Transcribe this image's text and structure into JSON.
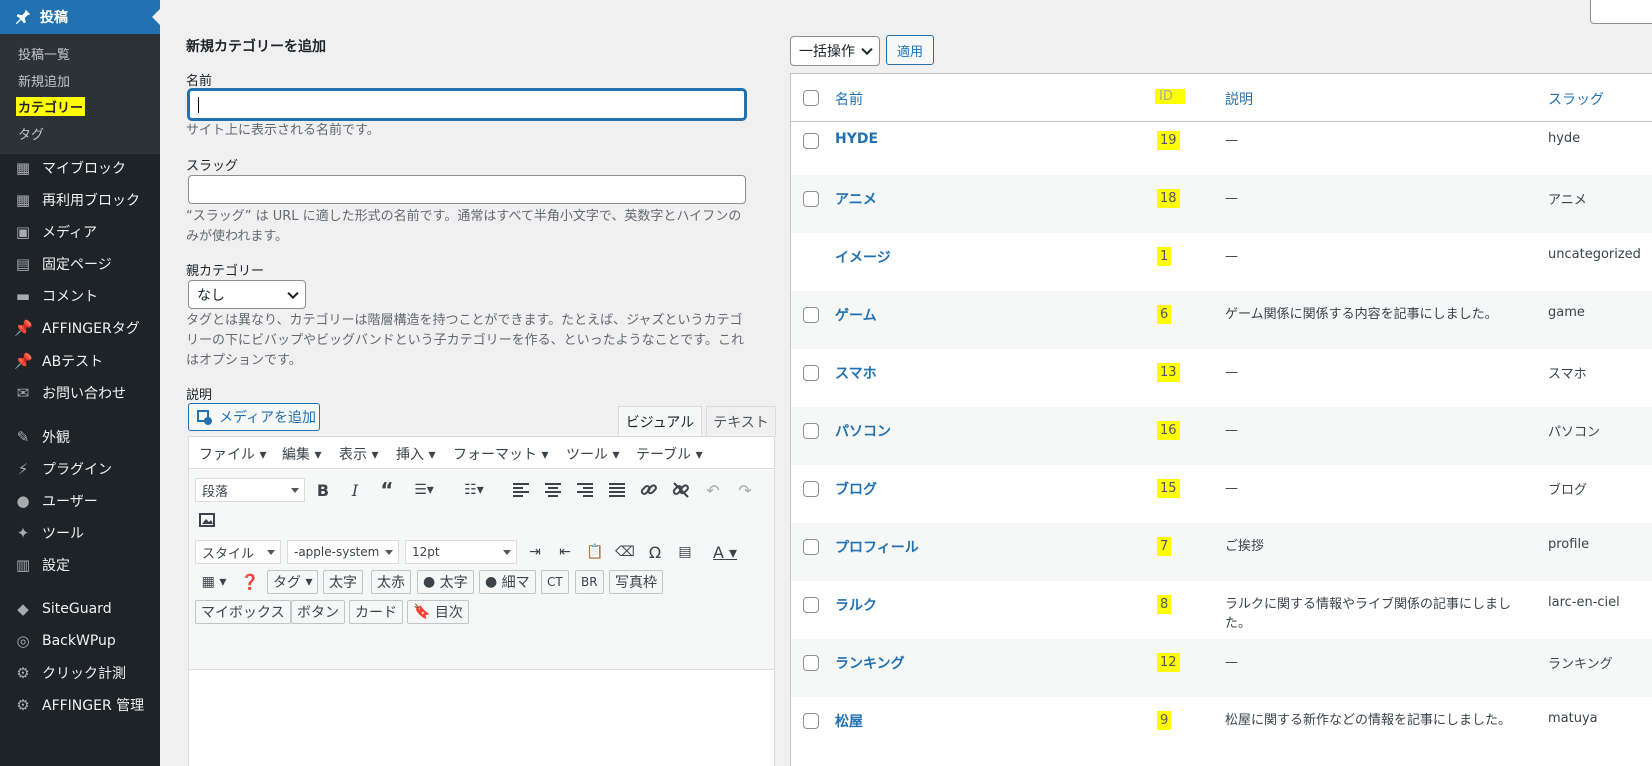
{
  "sidebar": {
    "active": {
      "label": "投稿",
      "icon": "pin-icon"
    },
    "submenu": [
      "投稿一覧",
      "新規追加",
      "カテゴリー",
      "タグ"
    ],
    "items": [
      {
        "label": "マイブロック",
        "icon": "grid-icon"
      },
      {
        "label": "再利用ブロック",
        "icon": "grid-icon"
      },
      {
        "label": "メディア",
        "icon": "media-icon"
      },
      {
        "label": "固定ページ",
        "icon": "pages-icon"
      },
      {
        "label": "コメント",
        "icon": "comment-icon"
      },
      {
        "label": "AFFINGERタグ",
        "icon": "pin-icon"
      },
      {
        "label": "ABテスト",
        "icon": "pin-icon"
      },
      {
        "label": "お問い合わせ",
        "icon": "mail-icon"
      },
      {
        "label": "外観",
        "icon": "brush-icon"
      },
      {
        "label": "プラグイン",
        "icon": "plugin-icon"
      },
      {
        "label": "ユーザー",
        "icon": "user-icon"
      },
      {
        "label": "ツール",
        "icon": "wrench-icon"
      },
      {
        "label": "設定",
        "icon": "settings-icon"
      },
      {
        "label": "SiteGuard",
        "icon": "shield-icon"
      },
      {
        "label": "BackWPup",
        "icon": "backup-icon"
      },
      {
        "label": "クリック計測",
        "icon": "gear-icon"
      },
      {
        "label": "AFFINGER 管理",
        "icon": "gear-icon"
      }
    ]
  },
  "form": {
    "heading": "新規カテゴリーを追加",
    "name_label": "名前",
    "name_value": "",
    "name_help": "サイト上に表示される名前です。",
    "slug_label": "スラッグ",
    "slug_value": "",
    "slug_help": "“スラッグ” は URL に適した形式の名前です。通常はすべて半角小文字で、英数字とハイフンのみが使われます。",
    "parent_label": "親カテゴリー",
    "parent_value": "なし",
    "parent_help": "タグとは異なり、カテゴリーは階層構造を持つことができます。たとえば、ジャズというカテゴリーの下にビバップやビッグバンドという子カテゴリーを作る、といったようなことです。これはオプションです。",
    "desc_label": "説明",
    "add_media": "メディアを追加",
    "tab_visual": "ビジュアル",
    "tab_text": "テキスト"
  },
  "editor": {
    "menu": [
      "ファイル ▾",
      "編集 ▾",
      "表示 ▾",
      "挿入 ▾",
      "フォーマット ▾",
      "ツール ▾",
      "テーブル ▾"
    ],
    "paragraph": "段落",
    "style": "スタイル",
    "font": "-apple-system",
    "size": "12pt",
    "row4": [
      "タグ",
      "太字",
      "太赤",
      "太字",
      "細マ",
      "CT",
      "BR",
      "写真枠"
    ],
    "row5": [
      "マイボックス",
      "ボタン",
      "カード",
      "目次"
    ]
  },
  "list": {
    "bulk": "一括操作",
    "apply": "適用",
    "headers": {
      "name": "名前",
      "id": "ID",
      "desc": "説明",
      "slug": "スラッグ"
    },
    "rows": [
      {
        "name": "HYDE",
        "id": "19",
        "desc": "—",
        "slug": "hyde",
        "checkbox": true
      },
      {
        "name": "アニメ",
        "id": "18",
        "desc": "—",
        "slug": "アニメ",
        "checkbox": true
      },
      {
        "name": "イメージ",
        "id": "1",
        "desc": "—",
        "slug": "uncategorized",
        "checkbox": false
      },
      {
        "name": "ゲーム",
        "id": "6",
        "desc": "ゲーム関係に関係する内容を記事にしました。",
        "slug": "game",
        "checkbox": true
      },
      {
        "name": "スマホ",
        "id": "13",
        "desc": "—",
        "slug": "スマホ",
        "checkbox": true
      },
      {
        "name": "パソコン",
        "id": "16",
        "desc": "—",
        "slug": "パソコン",
        "checkbox": true
      },
      {
        "name": "ブログ",
        "id": "15",
        "desc": "—",
        "slug": "ブログ",
        "checkbox": true
      },
      {
        "name": "プロフィール",
        "id": "7",
        "desc": "ご挨拶",
        "slug": "profile",
        "checkbox": true
      },
      {
        "name": "ラルク",
        "id": "8",
        "desc": "ラルクに関する情報やライブ関係の記事にしました。",
        "slug": "larc-en-ciel",
        "checkbox": true
      },
      {
        "name": "ランキング",
        "id": "12",
        "desc": "—",
        "slug": "ランキング",
        "checkbox": true
      },
      {
        "name": "松屋",
        "id": "9",
        "desc": "松屋に関する新作などの情報を記事にしました。",
        "slug": "matuya",
        "checkbox": true
      }
    ]
  },
  "colors": {
    "sidebar": "#1d2327",
    "active": "#2271b1",
    "highlight": "#ffff00",
    "link": "#2271b1"
  }
}
